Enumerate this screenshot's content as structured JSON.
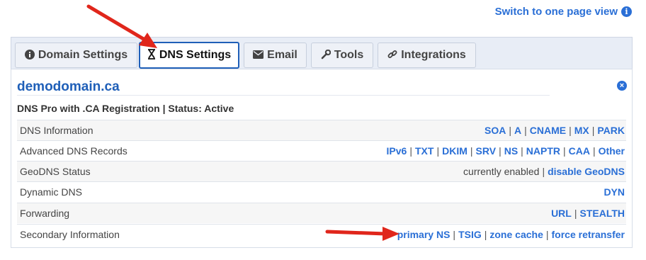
{
  "switch_view": {
    "label": "Switch to one page view"
  },
  "tabs": [
    {
      "label": "Domain Settings",
      "icon": "info-circle-icon"
    },
    {
      "label": "DNS Settings",
      "icon": "hourglass-icon",
      "active": true
    },
    {
      "label": "Email",
      "icon": "envelope-icon"
    },
    {
      "label": "Tools",
      "icon": "wrench-icon"
    },
    {
      "label": "Integrations",
      "icon": "link-icon"
    }
  ],
  "panel": {
    "domain": "demodomain.ca",
    "plan_line": "DNS Pro with .CA Registration | Status: Active"
  },
  "rows": [
    {
      "label": "DNS Information",
      "links": [
        "SOA",
        "A",
        "CNAME",
        "MX",
        "PARK"
      ]
    },
    {
      "label": "Advanced DNS Records",
      "links": [
        "IPv6",
        "TXT",
        "DKIM",
        "SRV",
        "NS",
        "NAPTR",
        "CAA",
        "Other"
      ]
    },
    {
      "label": "GeoDNS Status",
      "status_text": "currently enabled",
      "links": [
        "disable GeoDNS"
      ]
    },
    {
      "label": "Dynamic DNS",
      "links": [
        "DYN"
      ]
    },
    {
      "label": "Forwarding",
      "links": [
        "URL",
        "STEALTH"
      ]
    },
    {
      "label": "Secondary Information",
      "links": [
        "primary NS",
        "TSIG",
        "zone cache",
        "force retransfer"
      ]
    }
  ],
  "colors": {
    "accent": "#2a6fd6",
    "arrow": "#e0261b",
    "tab_bar": "#e8edf6"
  }
}
